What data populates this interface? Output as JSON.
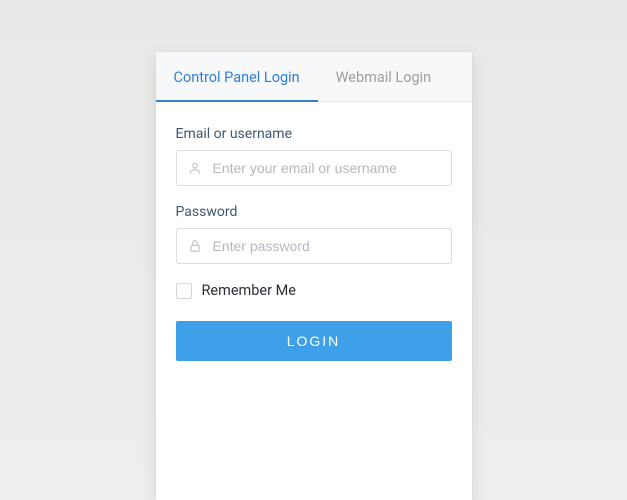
{
  "tabs": {
    "control_panel": "Control Panel Login",
    "webmail": "Webmail Login"
  },
  "fields": {
    "username": {
      "label": "Email or username",
      "placeholder": "Enter your email or username",
      "value": ""
    },
    "password": {
      "label": "Password",
      "placeholder": "Enter password",
      "value": ""
    }
  },
  "remember": {
    "label": "Remember Me",
    "checked": false
  },
  "login_button": "LOGIN",
  "colors": {
    "accent": "#3ea0e8",
    "tab_active": "#2f80d6"
  }
}
